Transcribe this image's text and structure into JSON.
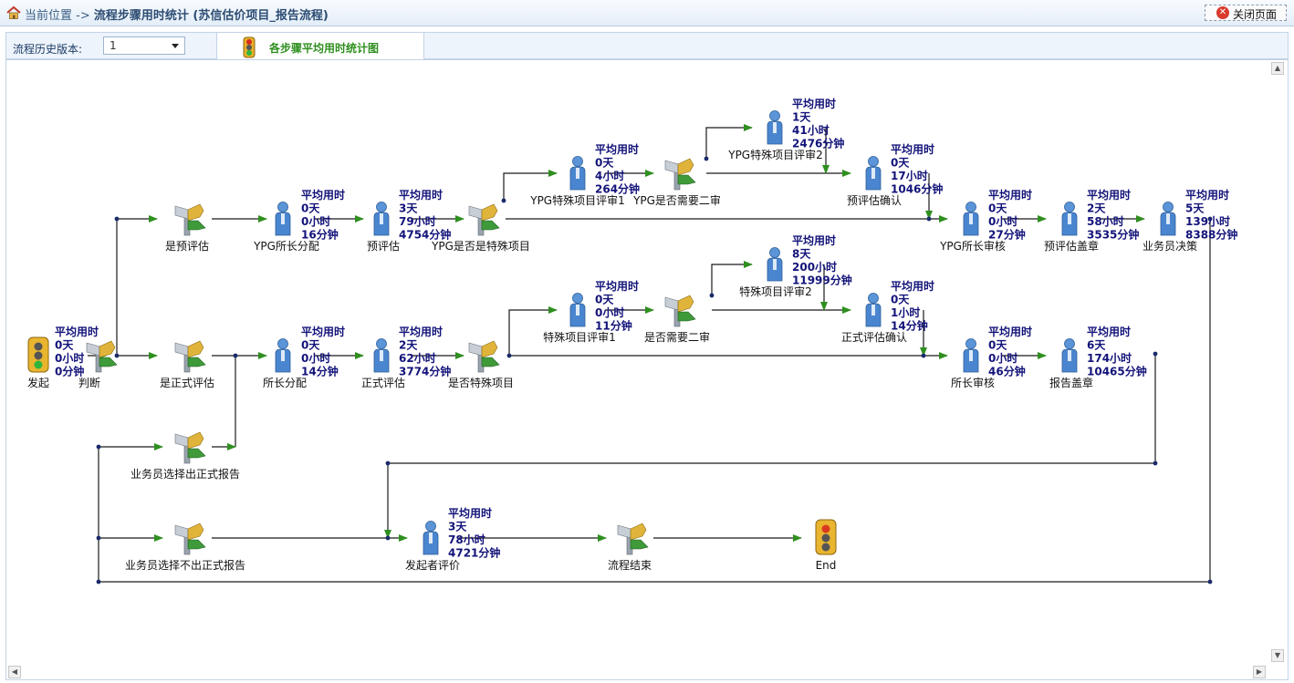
{
  "header": {
    "location_label": "当前位置",
    "arrow": "->",
    "page_title": "流程步骤用时统计 (苏信估价项目_报告流程)",
    "close_label": "关闭页面"
  },
  "toolbar": {
    "version_label": "流程历史版本:",
    "version_value": "1",
    "tab_label": "各步骤平均用时统计图"
  },
  "icons": {
    "home": "home-icon",
    "close": "close-circle-icon",
    "traffic_light": "traffic-light-icon",
    "user": "user-icon",
    "decision": "decision-icon"
  },
  "colors": {
    "stat_text": "#13137a",
    "arrow": "#2f8f1f",
    "line": "#1a1a1a",
    "tab_text": "#2f8f1f"
  },
  "stat_title": "平均用时",
  "nodes": [
    {
      "id": "start",
      "type": "light",
      "label": "发起",
      "stat": [
        "0天",
        "0小时",
        "0分钟"
      ]
    },
    {
      "id": "judge",
      "type": "decision",
      "label": "判断"
    },
    {
      "id": "is_pre",
      "type": "decision",
      "label": "是预评估"
    },
    {
      "id": "ypg_assign",
      "type": "user",
      "label": "YPG所长分配",
      "stat": [
        "0天",
        "0小时",
        "16分钟"
      ]
    },
    {
      "id": "pre_eval",
      "type": "user",
      "label": "预评估",
      "stat": [
        "3天",
        "79小时",
        "4754分钟"
      ]
    },
    {
      "id": "ypg_special_q",
      "type": "decision",
      "label": "YPG是否是特殊项目"
    },
    {
      "id": "ypg_review1",
      "type": "user",
      "label": "YPG特殊项目评审1",
      "stat": [
        "0天",
        "4小时",
        "264分钟"
      ]
    },
    {
      "id": "ypg_need2",
      "type": "decision",
      "label": "YPG是否需要二审"
    },
    {
      "id": "ypg_review2",
      "type": "user",
      "label": "YPG特殊项目评审2",
      "stat": [
        "1天",
        "41小时",
        "2476分钟"
      ]
    },
    {
      "id": "pre_confirm",
      "type": "user",
      "label": "预评估确认",
      "stat": [
        "0天",
        "17小时",
        "1046分钟"
      ]
    },
    {
      "id": "ypg_chief_review",
      "type": "user",
      "label": "YPG所长审核",
      "stat": [
        "0天",
        "0小时",
        "27分钟"
      ]
    },
    {
      "id": "pre_seal",
      "type": "user",
      "label": "预评估盖章",
      "stat": [
        "2天",
        "58小时",
        "3535分钟"
      ]
    },
    {
      "id": "biz_decide",
      "type": "user",
      "label": "业务员决策",
      "stat": [
        "5天",
        "139小时",
        "8388分钟"
      ]
    },
    {
      "id": "is_formal",
      "type": "decision",
      "label": "是正式评估"
    },
    {
      "id": "chief_assign",
      "type": "user",
      "label": "所长分配",
      "stat": [
        "0天",
        "0小时",
        "14分钟"
      ]
    },
    {
      "id": "formal_eval",
      "type": "user",
      "label": "正式评估",
      "stat": [
        "2天",
        "62小时",
        "3774分钟"
      ]
    },
    {
      "id": "special_q",
      "type": "decision",
      "label": "是否特殊项目"
    },
    {
      "id": "review1",
      "type": "user",
      "label": "特殊项目评审1",
      "stat": [
        "0天",
        "0小时",
        "11分钟"
      ]
    },
    {
      "id": "need2",
      "type": "decision",
      "label": "是否需要二审"
    },
    {
      "id": "review2",
      "type": "user",
      "label": "特殊项目评审2",
      "stat": [
        "8天",
        "200小时",
        "11999分钟"
      ]
    },
    {
      "id": "formal_confirm",
      "type": "user",
      "label": "正式评估确认",
      "stat": [
        "0天",
        "1小时",
        "14分钟"
      ]
    },
    {
      "id": "chief_review",
      "type": "user",
      "label": "所长审核",
      "stat": [
        "0天",
        "0小时",
        "46分钟"
      ]
    },
    {
      "id": "report_seal",
      "type": "user",
      "label": "报告盖章",
      "stat": [
        "6天",
        "174小时",
        "10465分钟"
      ]
    },
    {
      "id": "choose_formal",
      "type": "decision",
      "label": "业务员选择出正式报告"
    },
    {
      "id": "choose_no_formal",
      "type": "decision",
      "label": "业务员选择不出正式报告"
    },
    {
      "id": "initiator_eval",
      "type": "user",
      "label": "发起者评价",
      "stat": [
        "3天",
        "78小时",
        "4721分钟"
      ]
    },
    {
      "id": "flow_end",
      "type": "decision",
      "label": "流程结束"
    },
    {
      "id": "end",
      "type": "light_end",
      "label": "End"
    }
  ]
}
